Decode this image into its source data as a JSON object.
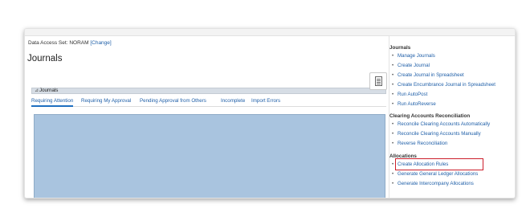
{
  "context": {
    "data_access_prefix": "Data Access Set:",
    "data_access_value": "NORAM",
    "change_link": "[Change]"
  },
  "page": {
    "title": "Journals"
  },
  "section": {
    "collapse_glyph": "⊿",
    "title": "Journals"
  },
  "tabs": [
    {
      "label": "Requiring Attention",
      "active": true
    },
    {
      "label": "Requiring My Approval",
      "active": false
    },
    {
      "label": "Pending Approval from Others",
      "active": false
    },
    {
      "label": "Incomplete",
      "active": false
    },
    {
      "label": "Import Errors",
      "active": false
    }
  ],
  "task_toggle": {
    "icon": "tasks-icon"
  },
  "panel": {
    "journals": {
      "title": "Journals",
      "items": [
        "Manage Journals",
        "Create Journal",
        "Create Journal in Spreadsheet",
        "Create Encumbrance Journal in Spreadsheet",
        "Run AutoPost",
        "Run AutoReverse"
      ]
    },
    "clearing": {
      "title": "Clearing Accounts Reconciliation",
      "items": [
        "Reconcile Clearing Accounts Automatically",
        "Reconcile Clearing Accounts Manually",
        "Reverse Reconciliation"
      ]
    },
    "allocations": {
      "title": "Allocations",
      "items": [
        "Create Allocation Rules",
        "Generate General Ledger Allocations",
        "Generate Intercompany Allocations"
      ]
    }
  },
  "colors": {
    "link": "#1f5fa8",
    "highlight": "#cc1e2b",
    "grid": "#a9c4df"
  }
}
